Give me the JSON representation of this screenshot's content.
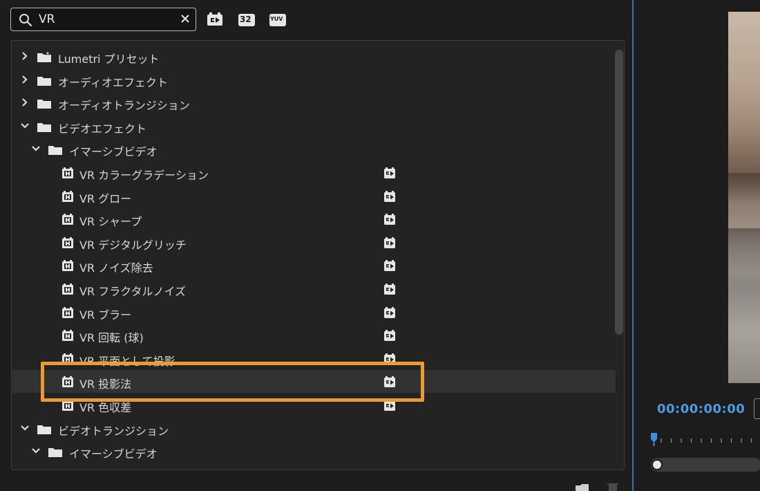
{
  "search": {
    "value": "VR"
  },
  "tree": {
    "rows": [
      {
        "label": "Lumetri プリセット",
        "type": "folder",
        "level": 0,
        "expanded": false,
        "special": "lumetri"
      },
      {
        "label": "オーディオエフェクト",
        "type": "folder",
        "level": 0,
        "expanded": false
      },
      {
        "label": "オーディオトランジション",
        "type": "folder",
        "level": 0,
        "expanded": false
      },
      {
        "label": "ビデオエフェクト",
        "type": "folder",
        "level": 0,
        "expanded": true
      },
      {
        "label": "イマーシブビデオ",
        "type": "folder",
        "level": 1,
        "expanded": true
      },
      {
        "label": "VR カラーグラデーション",
        "type": "effect",
        "accelerated": true
      },
      {
        "label": "VR グロー",
        "type": "effect",
        "accelerated": true
      },
      {
        "label": "VR シャープ",
        "type": "effect",
        "accelerated": true
      },
      {
        "label": "VR デジタルグリッチ",
        "type": "effect",
        "accelerated": true
      },
      {
        "label": "VR ノイズ除去",
        "type": "effect",
        "accelerated": true
      },
      {
        "label": "VR フラクタルノイズ",
        "type": "effect",
        "accelerated": true
      },
      {
        "label": "VR ブラー",
        "type": "effect",
        "accelerated": true
      },
      {
        "label": "VR 回転 (球)",
        "type": "effect",
        "accelerated": true
      },
      {
        "label": "VR 平面として投影",
        "type": "effect",
        "accelerated": true
      },
      {
        "label": "VR 投影法",
        "type": "effect",
        "accelerated": true,
        "selected": true
      },
      {
        "label": "VR 色収差",
        "type": "effect",
        "accelerated": true
      },
      {
        "label": "ビデオトランジション",
        "type": "folder",
        "level": 0,
        "expanded": true
      },
      {
        "label": "イマーシブビデオ",
        "type": "folder",
        "level": 1,
        "expanded": true
      }
    ]
  },
  "filters": {
    "accel_icon": "accelerated-effects-icon",
    "bit32_label": "32",
    "yuv_label": "YUV"
  },
  "monitor": {
    "timecode": "00:00:00:00"
  },
  "colors": {
    "highlight": "#ee9a33",
    "timecode": "#4d9de0",
    "panel_border": "#3a6fb7"
  }
}
